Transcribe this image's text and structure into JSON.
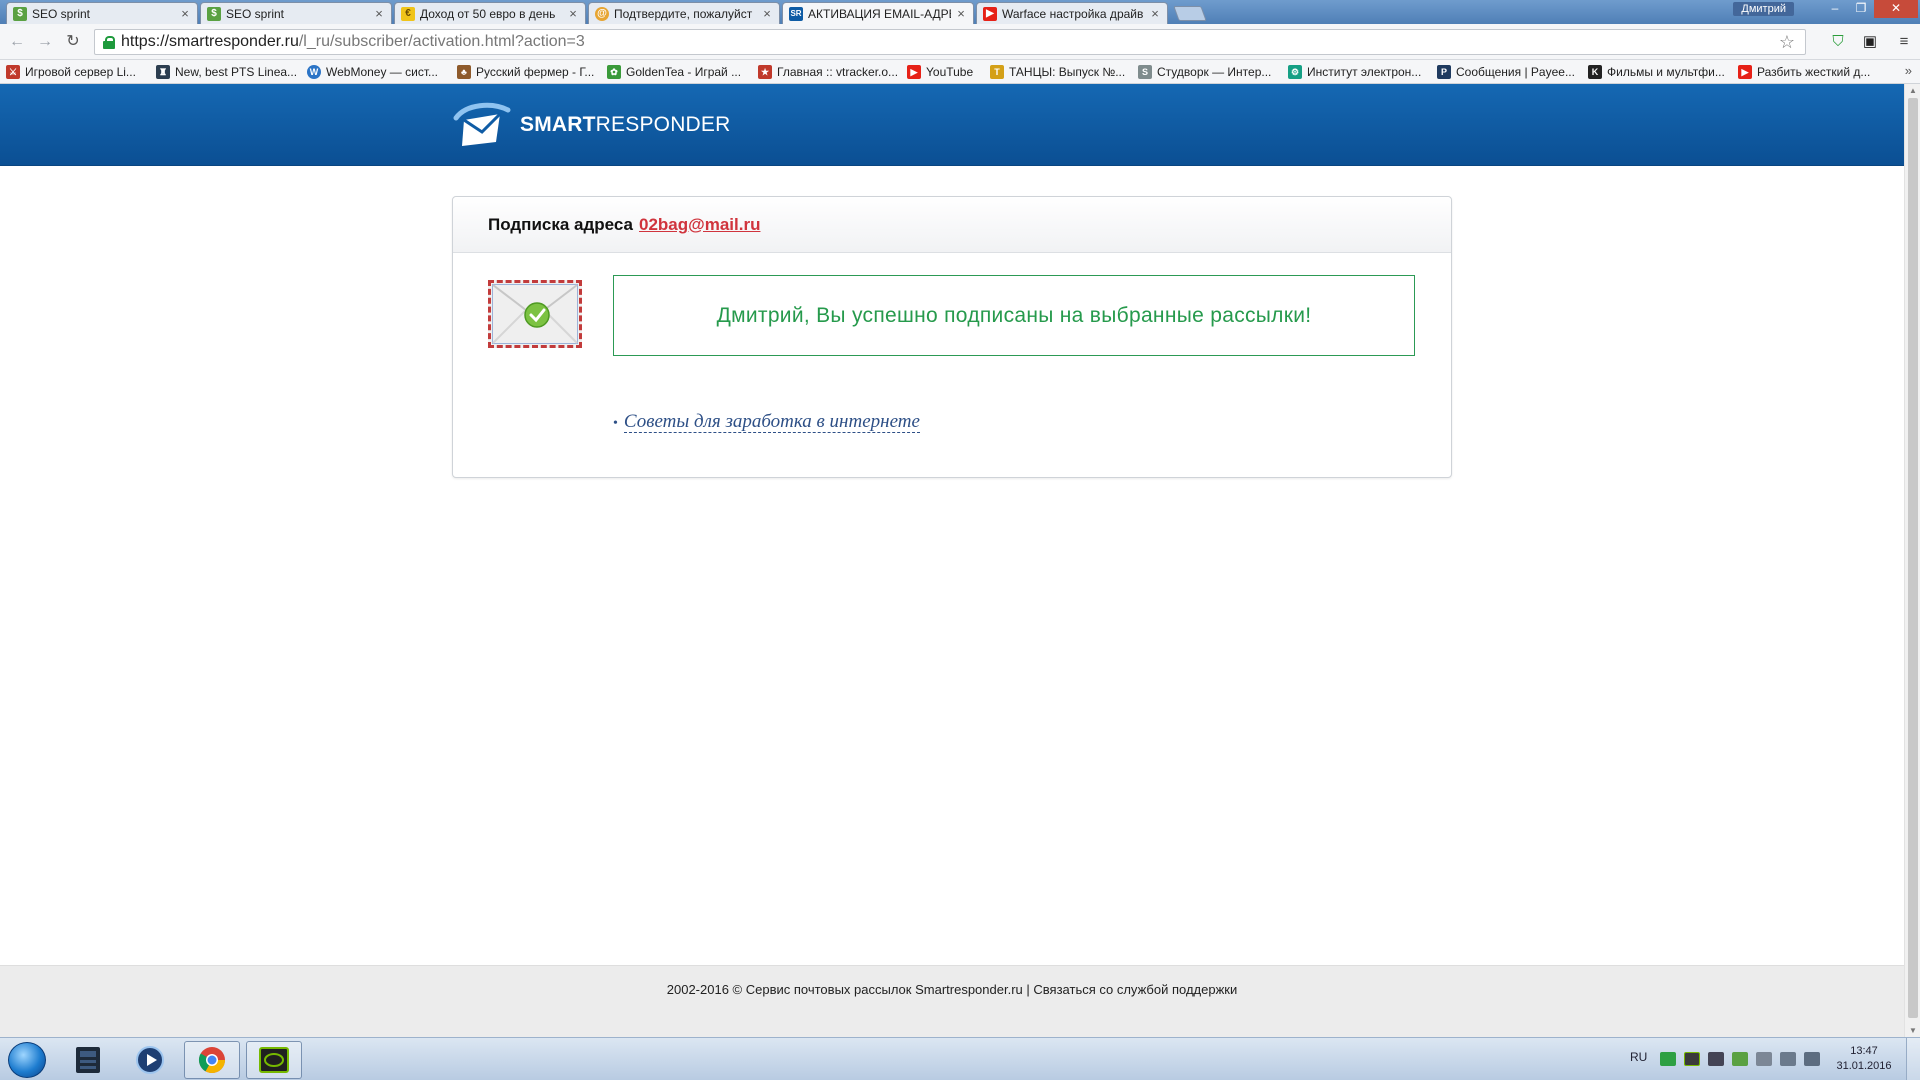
{
  "browser": {
    "tabs": [
      {
        "title": "SEO sprint",
        "favicon": "seo-sprint-icon",
        "active": false
      },
      {
        "title": "SEO sprint",
        "favicon": "seo-sprint-icon",
        "active": false
      },
      {
        "title": "Доход от 50 евро в день",
        "favicon": "euro-icon",
        "active": false
      },
      {
        "title": "Подтвердите, пожалуйст",
        "favicon": "mail-icon",
        "active": false
      },
      {
        "title": "АКТИВАЦИЯ EMAIL-АДРЕ",
        "favicon": "sr-icon",
        "active": true
      },
      {
        "title": "Warface настройка драйв",
        "favicon": "youtube-icon",
        "active": false
      }
    ],
    "user": "Дмитрий",
    "url_host": "https://smartresponder.ru",
    "url_path": "/l_ru/subscriber/activation.html?action=3",
    "bookmarks": [
      {
        "label": "Игровой сервер Li...",
        "icon": "game-icon",
        "color": "#c0392b"
      },
      {
        "label": "New, best PTS Linea...",
        "icon": "castle-icon",
        "color": "#2c3e50"
      },
      {
        "label": "WebMoney — сист...",
        "icon": "webmoney-icon",
        "color": "#2b74c6"
      },
      {
        "label": "Русский фермер - Г...",
        "icon": "farmer-icon",
        "color": "#8e5a2b"
      },
      {
        "label": "GoldenTea - Играй ...",
        "icon": "tea-icon",
        "color": "#3a9a3a"
      },
      {
        "label": "Главная :: vtracker.o...",
        "icon": "star-icon",
        "color": "#c0392b"
      },
      {
        "label": "YouTube",
        "icon": "youtube-icon",
        "color": "#e62117"
      },
      {
        "label": "ТАНЦЫ: Выпуск №...",
        "icon": "tnt-icon",
        "color": "#d4a017"
      },
      {
        "label": "Студворк — Интер...",
        "icon": "studwork-icon",
        "color": "#7f8c8d"
      },
      {
        "label": "Институт электрон...",
        "icon": "institute-icon",
        "color": "#16a085"
      },
      {
        "label": "Сообщения | Payee...",
        "icon": "payeer-icon",
        "color": "#1f3a5f"
      },
      {
        "label": "Фильмы и мультфи...",
        "icon": "kinopoisk-icon",
        "color": "#222222"
      },
      {
        "label": "Разбить жесткий д...",
        "icon": "youtube-icon",
        "color": "#e62117"
      }
    ]
  },
  "page": {
    "logo": {
      "bold": "SMART",
      "light": "RESPONDER"
    },
    "card": {
      "heading_prefix": "Подписка адреса",
      "email": "02bag@mail.ru",
      "success_message": "Дмитрий, Вы успешно подписаны на выбранные рассылки!",
      "tip_bullet": "•",
      "tip_link": "Советы для заработка в интернете"
    },
    "footer": {
      "copyright": "2002-2016 © Сервис почтовых рассылок Smartresponder.ru",
      "separator": "|",
      "support_link": "Связаться со службой поддержки"
    }
  },
  "taskbar": {
    "language": "RU",
    "time": "13:47",
    "date": "31.01.2016"
  },
  "colors": {
    "header_blue": "#0f5ca5",
    "success_green": "#269a4c",
    "email_red": "#d0343d",
    "tip_blue": "#2d4f86"
  }
}
